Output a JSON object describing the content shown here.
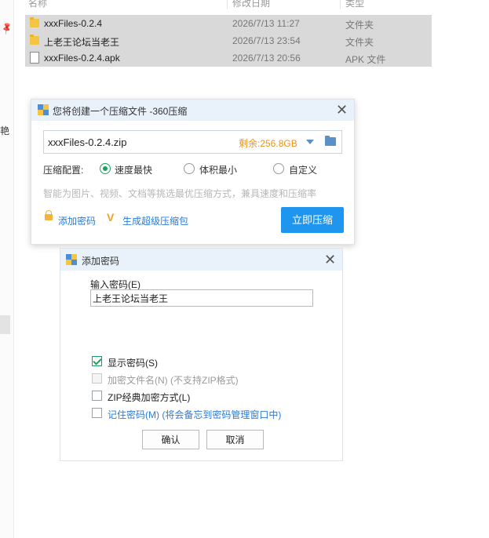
{
  "explorer": {
    "columns": [
      "名称",
      "修改日期",
      "类型"
    ],
    "files": [
      {
        "name": "xxxFiles-0.2.4",
        "date": "2026/7/13 11:27",
        "type": "文件夹",
        "icon": "folder-icon"
      },
      {
        "name": "上老王论坛当老王",
        "date": "2026/7/13 23:54",
        "type": "文件夹",
        "icon": "folder-icon"
      },
      {
        "name": "xxxFiles-0.2.4.apk",
        "date": "2026/7/13 20:56",
        "type": "APK 文件",
        "icon": "file-icon"
      }
    ],
    "left_pane_text": "艳"
  },
  "compress_dialog": {
    "title": "您将创建一个压缩文件 -360压缩",
    "path": "xxxFiles-0.2.4.zip",
    "free_space": "剩余:256.8GB",
    "config_label": "压缩配置:",
    "options": [
      {
        "label": "速度最快",
        "selected": true
      },
      {
        "label": "体积最小",
        "selected": false
      },
      {
        "label": "自定义",
        "selected": false
      }
    ],
    "hint": "智能为图片、视频、文档等挑选最优压缩方式，兼具速度和压缩率",
    "add_password_link": "添加密码",
    "super_pack_link": "生成超级压缩包",
    "compress_button": "立即压缩",
    "accent_color": "#1e96f0"
  },
  "password_dialog": {
    "title": "添加密码",
    "input_label": "输入密码(E)",
    "password_value": "上老王论坛当老王",
    "checkboxes": [
      {
        "label": "显示密码(S)",
        "checked": true,
        "disabled": false
      },
      {
        "label": "加密文件名(N) (不支持ZIP格式)",
        "checked": false,
        "disabled": true
      },
      {
        "label": "ZIP经典加密方式(L)",
        "checked": false,
        "disabled": false
      },
      {
        "label": "记住密码(M) (将会备忘到密码管理窗口中)",
        "checked": false,
        "disabled": false
      }
    ],
    "ok_button": "确认",
    "cancel_button": "取消"
  }
}
